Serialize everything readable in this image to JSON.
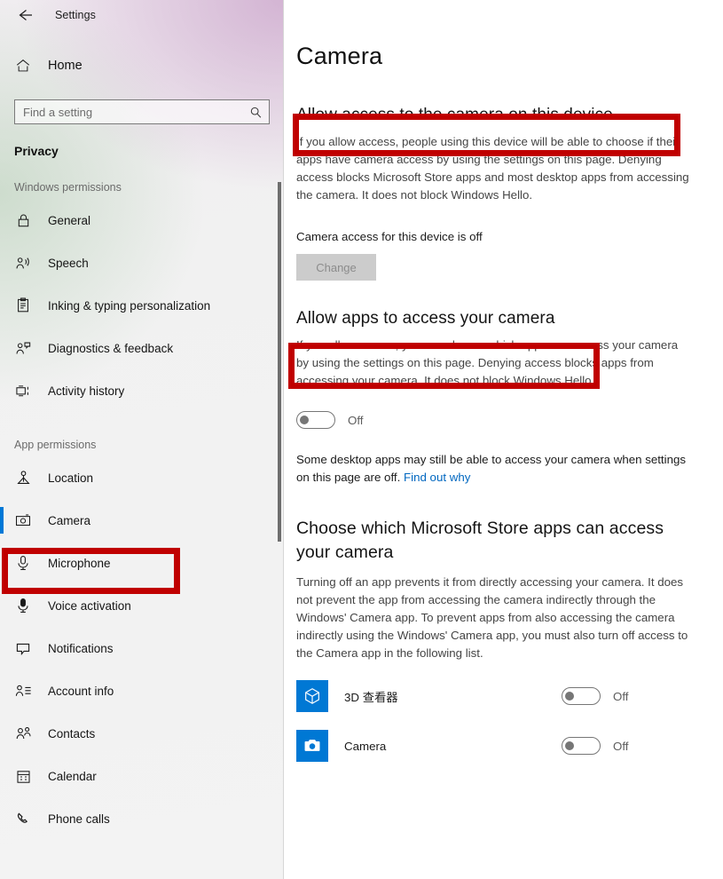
{
  "window": {
    "title": "Settings",
    "back_icon": "back-arrow-icon"
  },
  "sidebar": {
    "home_label": "Home",
    "home_icon": "home-icon",
    "search": {
      "placeholder": "Find a setting",
      "value": "",
      "icon": "search-icon"
    },
    "category": "Privacy",
    "groups": [
      {
        "header": "Windows permissions",
        "items": [
          {
            "label": "General",
            "icon": "lock-icon"
          },
          {
            "label": "Speech",
            "icon": "speech-person-icon"
          },
          {
            "label": "Inking & typing personalization",
            "icon": "clipboard-pen-icon"
          },
          {
            "label": "Diagnostics & feedback",
            "icon": "person-feedback-icon"
          },
          {
            "label": "Activity history",
            "icon": "activity-history-icon"
          }
        ]
      },
      {
        "header": "App permissions",
        "items": [
          {
            "label": "Location",
            "icon": "location-pin-icon"
          },
          {
            "label": "Camera",
            "icon": "camera-icon",
            "selected": true
          },
          {
            "label": "Microphone",
            "icon": "microphone-icon"
          },
          {
            "label": "Voice activation",
            "icon": "voice-activation-icon"
          },
          {
            "label": "Notifications",
            "icon": "notification-bubble-icon"
          },
          {
            "label": "Account info",
            "icon": "account-info-icon"
          },
          {
            "label": "Contacts",
            "icon": "contacts-icon"
          },
          {
            "label": "Calendar",
            "icon": "calendar-icon"
          },
          {
            "label": "Phone calls",
            "icon": "phone-icon"
          }
        ]
      }
    ]
  },
  "main": {
    "page_title": "Camera",
    "device_section": {
      "heading": "Allow access to the camera on this device",
      "description": "If you allow access, people using this device will be able to choose if their apps have camera access by using the settings on this page. Denying access blocks Microsoft Store apps and most desktop apps from accessing the camera. It does not block Windows Hello.",
      "status": "Camera access for this device is off",
      "change_button": "Change"
    },
    "apps_section": {
      "heading": "Allow apps to access your camera",
      "description": "If you allow access, you can choose which apps can access your camera by using the settings on this page. Denying access blocks apps from accessing your camera. It does not block Windows Hello.",
      "toggle_state": "Off",
      "note_prefix": "Some desktop apps may still be able to access your camera when settings on this page are off. ",
      "note_link": "Find out why"
    },
    "store_apps_section": {
      "heading": "Choose which Microsoft Store apps can access your camera",
      "description": "Turning off an app prevents it from directly accessing your camera. It does not prevent the app from accessing the camera indirectly through the Windows' Camera app. To prevent apps from also accessing the camera indirectly using the Windows' Camera app, you must also turn off access to the Camera app in the following list.",
      "apps": [
        {
          "name": "3D 查看器",
          "icon": "cube-3d-viewer-icon",
          "state": "Off",
          "tile_color": "#0078d4"
        },
        {
          "name": "Camera",
          "icon": "camera-app-icon",
          "state": "Off",
          "tile_color": "#0078d4"
        }
      ]
    }
  },
  "annotations": {
    "color": "#c00000",
    "boxes": [
      {
        "name": "highlight-device-heading"
      },
      {
        "name": "highlight-apps-heading"
      },
      {
        "name": "highlight-sidebar-camera"
      }
    ]
  },
  "colors": {
    "accent": "#0078d7",
    "link": "#0067c0",
    "annotation": "#c00000",
    "tile": "#0078d4"
  }
}
